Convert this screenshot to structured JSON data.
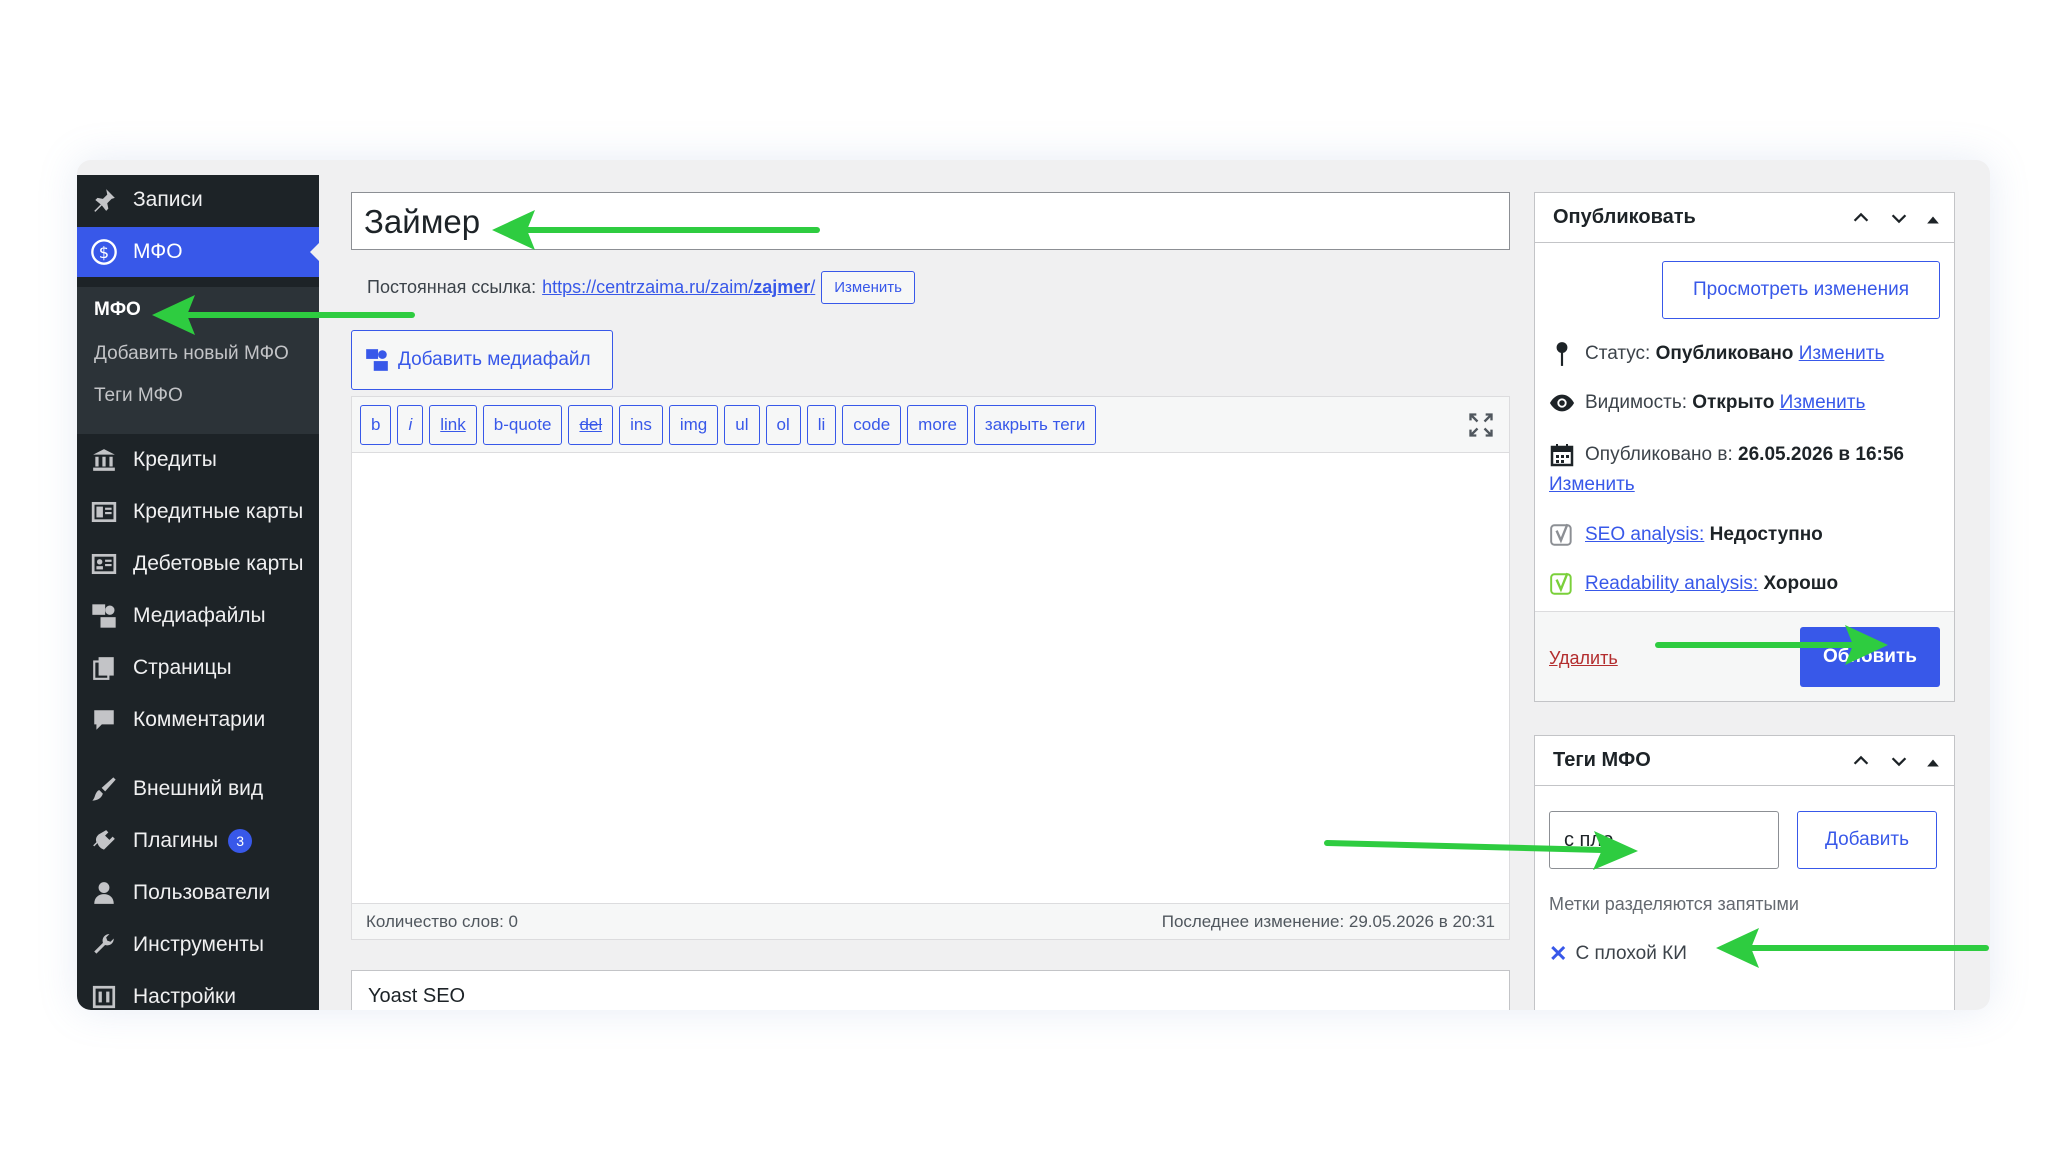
{
  "sidebar": {
    "items": [
      {
        "label": "Записи",
        "icon": "pin-icon"
      },
      {
        "label": "МФО",
        "icon": "dollar-icon"
      },
      {
        "label": "Кредиты",
        "icon": "bank-icon"
      },
      {
        "label": "Кредитные карты",
        "icon": "card-icon"
      },
      {
        "label": "Дебетовые карты",
        "icon": "id-card-icon"
      },
      {
        "label": "Медиафайлы",
        "icon": "media-icon"
      },
      {
        "label": "Страницы",
        "icon": "pages-icon"
      },
      {
        "label": "Комментарии",
        "icon": "comment-icon"
      },
      {
        "label": "Внешний вид",
        "icon": "brush-icon"
      },
      {
        "label": "Плагины",
        "icon": "plugin-icon",
        "badge": "3"
      },
      {
        "label": "Пользователи",
        "icon": "user-icon"
      },
      {
        "label": "Инструменты",
        "icon": "wrench-icon"
      },
      {
        "label": "Настройки",
        "icon": "settings-icon"
      }
    ],
    "submenu": [
      "МФО",
      "Добавить новый МФО",
      "Теги МФО"
    ]
  },
  "editor": {
    "title": "Займер",
    "permalink_label": "Постоянная ссылка:",
    "permalink_base": "https://centrzaima.ru/zaim/",
    "permalink_slug": "zajmer",
    "permalink_end": "/",
    "edit_btn": "Изменить",
    "add_media": "Добавить медиафайл",
    "quicktags": [
      "b",
      "i",
      "link",
      "b-quote",
      "del",
      "ins",
      "img",
      "ul",
      "ol",
      "li",
      "code",
      "more",
      "закрыть теги"
    ],
    "word_count": "Количество слов: 0",
    "last_edit": "Последнее изменение: 29.05.2026 в 20:31",
    "yoast_title": "Yoast SEO"
  },
  "publish": {
    "title": "Опубликовать",
    "preview": "Просмотреть изменения",
    "status_label": "Статус:",
    "status_value": "Опубликовано",
    "visibility_label": "Видимость:",
    "visibility_value": "Открыто",
    "published_label": "Опубликовано в:",
    "published_value": "26.05.2026 в 16:56",
    "edit": "Изменить",
    "seo_link": "SEO analysis:",
    "seo_value": "Недоступно",
    "read_link": "Readability analysis:",
    "read_value": "Хорошо",
    "delete": "Удалить",
    "update": "Обновить"
  },
  "tags": {
    "title": "Теги МФО",
    "input_value": "с пло",
    "add": "Добавить",
    "hint": "Метки разделяются запятыми",
    "chip": "С плохой КИ"
  },
  "colors": {
    "accent": "#3858e9",
    "sidebar": "#1d2327",
    "arrow": "#2ecc40"
  }
}
